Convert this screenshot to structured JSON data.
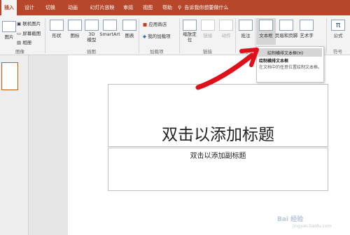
{
  "tabs": [
    "插入",
    "设计",
    "切换",
    "动画",
    "幻灯片放映",
    "审阅",
    "视图",
    "帮助"
  ],
  "tell_me": "告诉我你想要做什么",
  "ribbon": {
    "images": {
      "screenshot_label": "屏幕截图",
      "photo_label": "联机图片",
      "album_label": "相册",
      "big_label": "图片",
      "group": "图像"
    },
    "shapes": "形状",
    "icons": "图标",
    "model3d": "3D\n模型",
    "smartart": "SmartArt",
    "chart": "图表",
    "illus_group": "插图",
    "store": "应用商店",
    "myaddins": "我的加载项",
    "addins_group": "加载项",
    "zoom": "缩放定\n位",
    "link": "链接",
    "action": "动作",
    "links_group": "链接",
    "comment": "批注",
    "comments_group": "批注",
    "textbox": "文本框",
    "header_footer": "页眉和页脚",
    "wordart": "艺术字",
    "formula": "公式",
    "symbols_group": "符号"
  },
  "menu": {
    "item1": "绘制横排文本框(H)",
    "tip_title": "绘制横排文本框",
    "tip_desc": "在文档中的任意位置绘制文本框。"
  },
  "slide": {
    "title": "双击以添加标题",
    "subtitle": "双击以添加副标题"
  },
  "watermark": "Bai 经验",
  "watermark_url": "jingyan.baidu.com"
}
